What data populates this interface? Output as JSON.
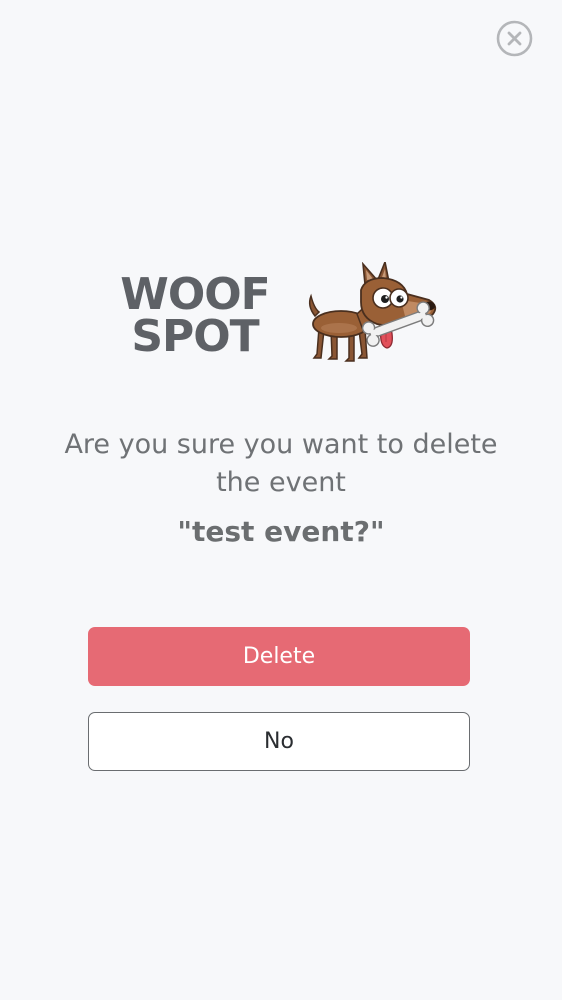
{
  "header": {
    "close_icon": "close-circle-icon"
  },
  "logo": {
    "line1": "WOOF",
    "line2": "SPOT",
    "mascot": "dog-with-bone-illustration"
  },
  "dialog": {
    "question": "Are you sure you want to delete the event",
    "event_name": "\"test event?\""
  },
  "buttons": {
    "delete_label": "Delete",
    "no_label": "No"
  },
  "colors": {
    "background": "#f7f8fa",
    "delete_button": "#e66a74",
    "wordmark": "#5e6166",
    "text": "#6f7275",
    "no_button_border": "#6a6d70"
  }
}
